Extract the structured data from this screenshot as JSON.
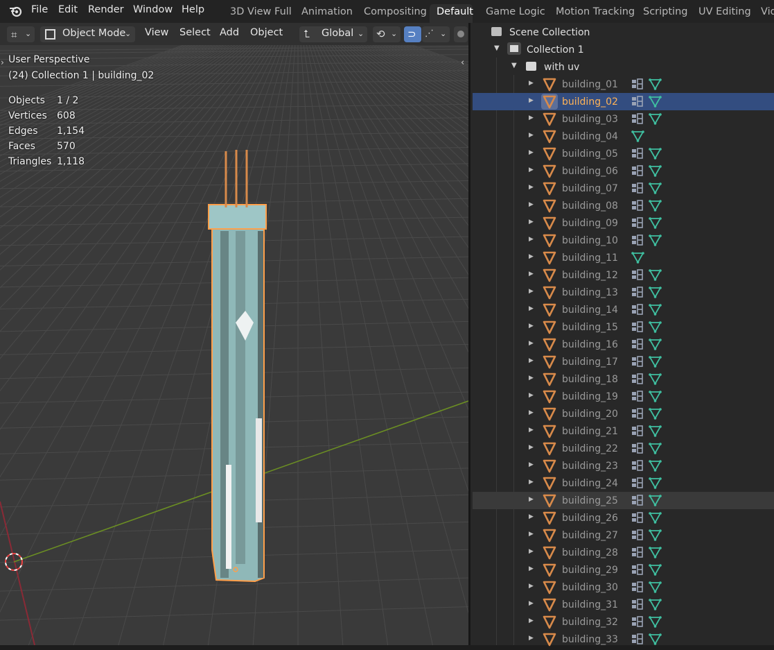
{
  "menu": {
    "file": "File",
    "edit": "Edit",
    "render": "Render",
    "window": "Window",
    "help": "Help"
  },
  "workspaces": [
    "3D View Full",
    "Animation",
    "Compositing",
    "Default",
    "Game Logic",
    "Motion Tracking",
    "Scripting",
    "UV Editing",
    "Vid"
  ],
  "active_workspace": "Default",
  "viewport_header": {
    "mode": "Object Mode",
    "view": "View",
    "select": "Select",
    "add": "Add",
    "object": "Object",
    "orientation": "Global"
  },
  "overlay": {
    "perspective": "User Perspective",
    "context": "(24) Collection 1 | building_02",
    "stats": [
      {
        "label": "Objects",
        "value": "1 / 2"
      },
      {
        "label": "Vertices",
        "value": "608"
      },
      {
        "label": "Edges",
        "value": "1,154"
      },
      {
        "label": "Faces",
        "value": "570"
      },
      {
        "label": "Triangles",
        "value": "1,118"
      }
    ]
  },
  "outliner": {
    "scene_collection": "Scene Collection",
    "collection": "Collection 1",
    "subcollection": "with uv",
    "items": [
      {
        "name": "building_01",
        "modifier": true
      },
      {
        "name": "building_02",
        "modifier": true,
        "selected": true
      },
      {
        "name": "building_03",
        "modifier": true
      },
      {
        "name": "building_04",
        "modifier": false
      },
      {
        "name": "building_05",
        "modifier": true
      },
      {
        "name": "building_06",
        "modifier": true
      },
      {
        "name": "building_07",
        "modifier": true
      },
      {
        "name": "building_08",
        "modifier": true
      },
      {
        "name": "building_09",
        "modifier": true
      },
      {
        "name": "building_10",
        "modifier": true
      },
      {
        "name": "building_11",
        "modifier": false
      },
      {
        "name": "building_12",
        "modifier": true
      },
      {
        "name": "building_13",
        "modifier": true
      },
      {
        "name": "building_14",
        "modifier": true
      },
      {
        "name": "building_15",
        "modifier": true
      },
      {
        "name": "building_16",
        "modifier": true
      },
      {
        "name": "building_17",
        "modifier": true
      },
      {
        "name": "building_18",
        "modifier": true
      },
      {
        "name": "building_19",
        "modifier": true
      },
      {
        "name": "building_20",
        "modifier": true
      },
      {
        "name": "building_21",
        "modifier": true
      },
      {
        "name": "building_22",
        "modifier": true
      },
      {
        "name": "building_23",
        "modifier": true
      },
      {
        "name": "building_24",
        "modifier": true
      },
      {
        "name": "building_25",
        "modifier": true,
        "hovered": true
      },
      {
        "name": "building_26",
        "modifier": true
      },
      {
        "name": "building_27",
        "modifier": true
      },
      {
        "name": "building_28",
        "modifier": true
      },
      {
        "name": "building_29",
        "modifier": true
      },
      {
        "name": "building_30",
        "modifier": true
      },
      {
        "name": "building_31",
        "modifier": true
      },
      {
        "name": "building_32",
        "modifier": true
      },
      {
        "name": "building_33",
        "modifier": true
      }
    ]
  },
  "colors": {
    "selection": "#ffb357",
    "row_selected": "#334d80",
    "mesh": "#d88a4a",
    "data": "#3fbfa0",
    "grid_bg": "#393939",
    "axis_x": "#8a2a36",
    "axis_y": "#6b8e23"
  }
}
